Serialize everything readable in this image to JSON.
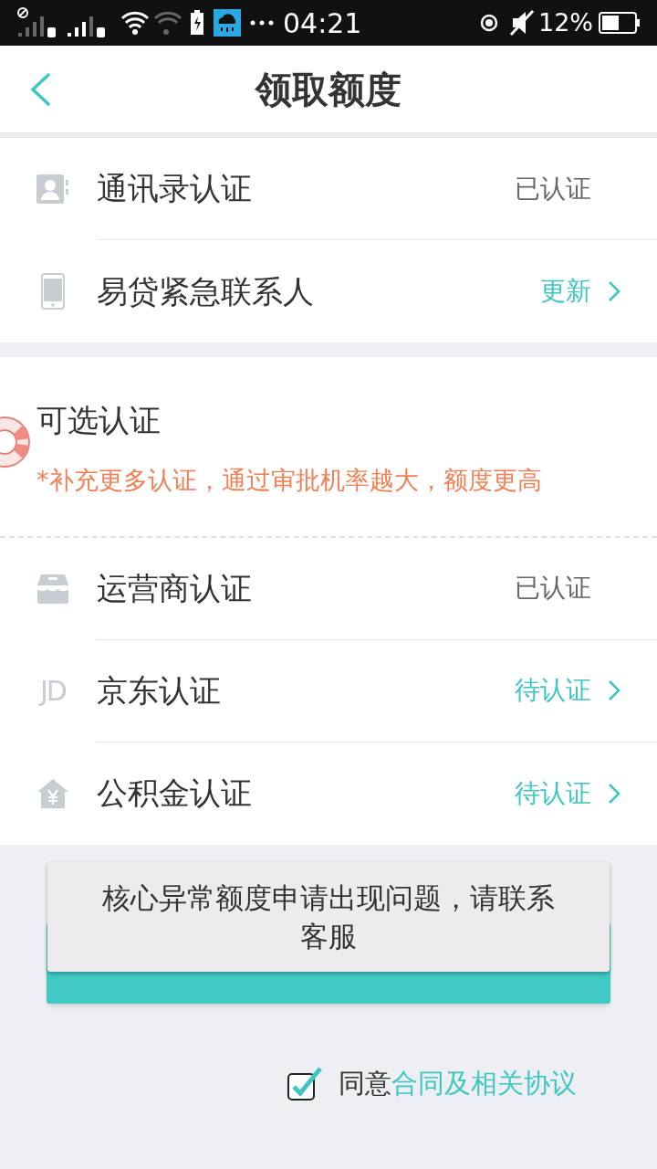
{
  "status_bar": {
    "time": "04:21",
    "battery": "12%"
  },
  "header": {
    "title": "领取额度"
  },
  "required_section": {
    "rows": [
      {
        "label": "通讯录认证",
        "status": "已认证",
        "kind": "done"
      },
      {
        "label": "易贷紧急联系人",
        "status": "更新",
        "kind": "action"
      }
    ]
  },
  "optional_section": {
    "title": "可选认证",
    "note": "*补充更多认证，通过审批机率越大，额度更高",
    "rows": [
      {
        "label": "运营商认证",
        "status": "已认证",
        "kind": "done"
      },
      {
        "label": "京东认证",
        "status": "待认证",
        "kind": "action",
        "icon_text": "JD"
      },
      {
        "label": "公积金认证",
        "status": "待认证",
        "kind": "action"
      }
    ]
  },
  "toast": {
    "message": "核心异常额度申请出现问题，请联系客服"
  },
  "agreement": {
    "checked": true,
    "text": "同意",
    "link": "合同及相关协议"
  }
}
